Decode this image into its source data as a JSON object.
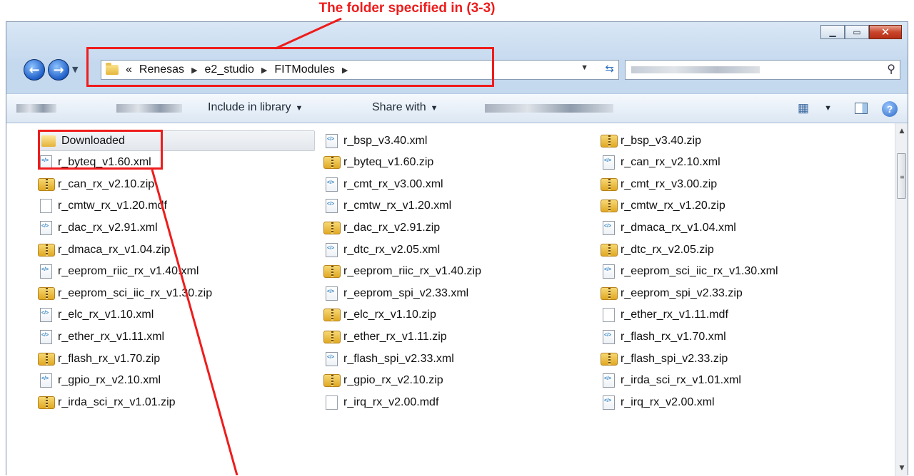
{
  "annotation": {
    "label": "The folder specified in (3-3)",
    "color": "#ee1c1c"
  },
  "window": {
    "caption_buttons": [
      "minimize",
      "maximize",
      "close"
    ]
  },
  "address_bar": {
    "overflow": "«",
    "crumbs": [
      "Renesas",
      "e2_studio",
      "FITModules"
    ]
  },
  "toolbar": {
    "include_in_library": "Include in library",
    "share_with": "Share with"
  },
  "files": [
    {
      "name": "Downloaded",
      "type": "folder"
    },
    {
      "name": "r_byteq_v1.60.xml",
      "type": "xml"
    },
    {
      "name": "r_can_rx_v2.10.zip",
      "type": "zip"
    },
    {
      "name": "r_cmtw_rx_v1.20.mdf",
      "type": "mdf"
    },
    {
      "name": "r_dac_rx_v2.91.xml",
      "type": "xml"
    },
    {
      "name": "r_dmaca_rx_v1.04.zip",
      "type": "zip"
    },
    {
      "name": "r_eeprom_riic_rx_v1.40.xml",
      "type": "xml"
    },
    {
      "name": "r_eeprom_sci_iic_rx_v1.30.zip",
      "type": "zip"
    },
    {
      "name": "r_elc_rx_v1.10.xml",
      "type": "xml"
    },
    {
      "name": "r_ether_rx_v1.11.xml",
      "type": "xml"
    },
    {
      "name": "r_flash_rx_v1.70.zip",
      "type": "zip"
    },
    {
      "name": "r_gpio_rx_v2.10.xml",
      "type": "xml"
    },
    {
      "name": "r_irda_sci_rx_v1.01.zip",
      "type": "zip"
    },
    {
      "name": "r_bsp_v3.40.xml",
      "type": "xml"
    },
    {
      "name": "r_byteq_v1.60.zip",
      "type": "zip"
    },
    {
      "name": "r_cmt_rx_v3.00.xml",
      "type": "xml"
    },
    {
      "name": "r_cmtw_rx_v1.20.xml",
      "type": "xml"
    },
    {
      "name": "r_dac_rx_v2.91.zip",
      "type": "zip"
    },
    {
      "name": "r_dtc_rx_v2.05.xml",
      "type": "xml"
    },
    {
      "name": "r_eeprom_riic_rx_v1.40.zip",
      "type": "zip"
    },
    {
      "name": "r_eeprom_spi_v2.33.xml",
      "type": "xml"
    },
    {
      "name": "r_elc_rx_v1.10.zip",
      "type": "zip"
    },
    {
      "name": "r_ether_rx_v1.11.zip",
      "type": "zip"
    },
    {
      "name": "r_flash_spi_v2.33.xml",
      "type": "xml"
    },
    {
      "name": "r_gpio_rx_v2.10.zip",
      "type": "zip"
    },
    {
      "name": "r_irq_rx_v2.00.mdf",
      "type": "mdf"
    },
    {
      "name": "r_bsp_v3.40.zip",
      "type": "zip"
    },
    {
      "name": "r_can_rx_v2.10.xml",
      "type": "xml"
    },
    {
      "name": "r_cmt_rx_v3.00.zip",
      "type": "zip"
    },
    {
      "name": "r_cmtw_rx_v1.20.zip",
      "type": "zip"
    },
    {
      "name": "r_dmaca_rx_v1.04.xml",
      "type": "xml"
    },
    {
      "name": "r_dtc_rx_v2.05.zip",
      "type": "zip"
    },
    {
      "name": "r_eeprom_sci_iic_rx_v1.30.xml",
      "type": "xml"
    },
    {
      "name": "r_eeprom_spi_v2.33.zip",
      "type": "zip"
    },
    {
      "name": "r_ether_rx_v1.11.mdf",
      "type": "mdf"
    },
    {
      "name": "r_flash_rx_v1.70.xml",
      "type": "xml"
    },
    {
      "name": "r_flash_spi_v2.33.zip",
      "type": "zip"
    },
    {
      "name": "r_irda_sci_rx_v1.01.xml",
      "type": "xml"
    },
    {
      "name": "r_irq_rx_v2.00.xml",
      "type": "xml"
    }
  ]
}
